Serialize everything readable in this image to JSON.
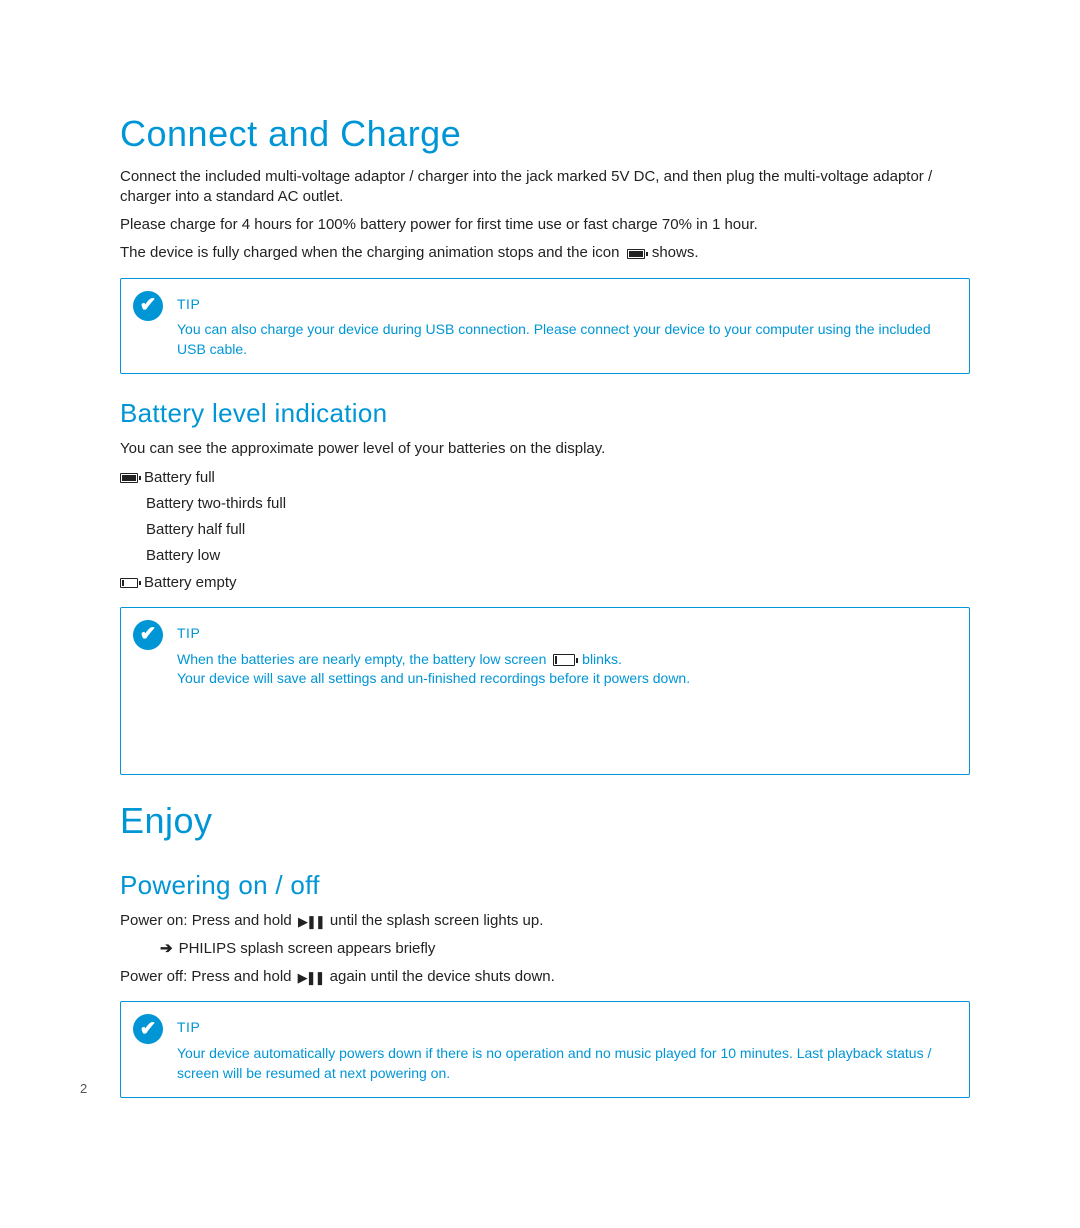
{
  "section1": {
    "heading": "Connect and Charge",
    "p1": "Connect the included multi-voltage adaptor / charger into the jack marked 5V DC, and then plug the multi-voltage adaptor / charger into a standard AC outlet.",
    "p2": "Please charge for 4 hours for 100% battery power for first time use or fast charge 70% in 1 hour.",
    "p3a": "The device is fully charged when the charging animation stops and the icon",
    "p3b": "shows.",
    "tip": {
      "label": "TIP",
      "text": "You can also charge your device during USB connection.  Please connect your device to your computer using the included USB cable."
    }
  },
  "section2": {
    "heading": "Battery level indication",
    "intro": "You can see the approximate power level of your batteries on the display.",
    "levels": {
      "full": "Battery full",
      "two_thirds": "Battery two-thirds full",
      "half": "Battery half full",
      "low": "Battery low",
      "empty": "Battery empty"
    },
    "tip": {
      "label": "TIP",
      "line1a": "When the batteries are nearly empty, the battery low screen",
      "line1b": "blinks.",
      "line2": "Your device will save all settings and un-finished recordings before it powers down."
    }
  },
  "section3": {
    "heading": "Enjoy",
    "sub": "Powering on / off",
    "p_on_a": "Power on: Press and hold",
    "p_on_b": "until the splash screen lights up.",
    "splash": "PHILIPS splash screen appears briefly",
    "p_off_a": "Power off: Press and hold",
    "p_off_b": "again until the device shuts down.",
    "tip": {
      "label": "TIP",
      "text": "Your device automatically powers down if there is no operation and no music played for 10 minutes.  Last playback status / screen will be resumed at next powering on."
    }
  },
  "page_number": "2"
}
